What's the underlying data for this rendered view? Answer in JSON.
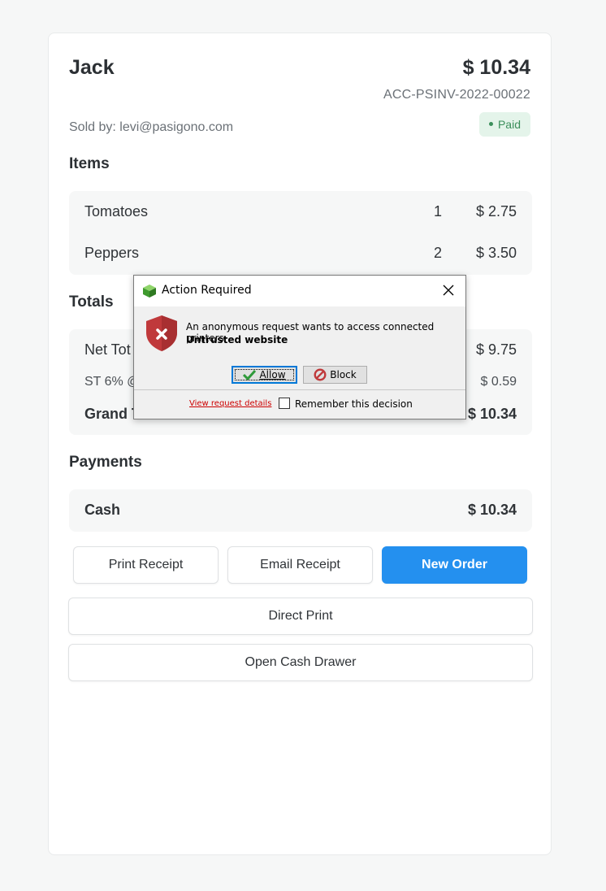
{
  "order": {
    "customer": "Jack",
    "grand_total": "$ 10.34",
    "invoice_id": "ACC-PSINV-2022-00022",
    "sold_by": "Sold by: levi@pasigono.com",
    "status": "Paid"
  },
  "items_section": {
    "title": "Items",
    "rows": [
      {
        "name": "Tomatoes",
        "qty": "1",
        "amount": "$ 2.75"
      },
      {
        "name": "Peppers",
        "qty": "2",
        "amount": "$ 3.50"
      }
    ]
  },
  "totals_section": {
    "title": "Totals",
    "net_total_label": "Net Tot",
    "net_total_value": "$ 9.75",
    "tax_label": "ST 6% @",
    "tax_value": "$ 0.59",
    "grand_total_label": "Grand T",
    "grand_total_value": "$ 10.34"
  },
  "payments_section": {
    "title": "Payments",
    "method": "Cash",
    "amount": "$ 10.34"
  },
  "actions": {
    "print_receipt": "Print Receipt",
    "email_receipt": "Email Receipt",
    "new_order": "New Order",
    "direct_print": "Direct Print",
    "open_cash_drawer": "Open Cash Drawer"
  },
  "dialog": {
    "title": "Action Required",
    "message": "An anonymous request wants to access connected printers",
    "subtitle": "Untrusted website",
    "allow_label": "Allow",
    "block_label": "Block",
    "details_link": "View request details",
    "remember_label": "Remember this decision",
    "remember_checked": false
  },
  "colors": {
    "primary": "#2490ef",
    "paid_bg": "#e4f4ea",
    "paid_text": "#3b8f5b",
    "shield": "#c0393b",
    "link": "#cc0000"
  }
}
